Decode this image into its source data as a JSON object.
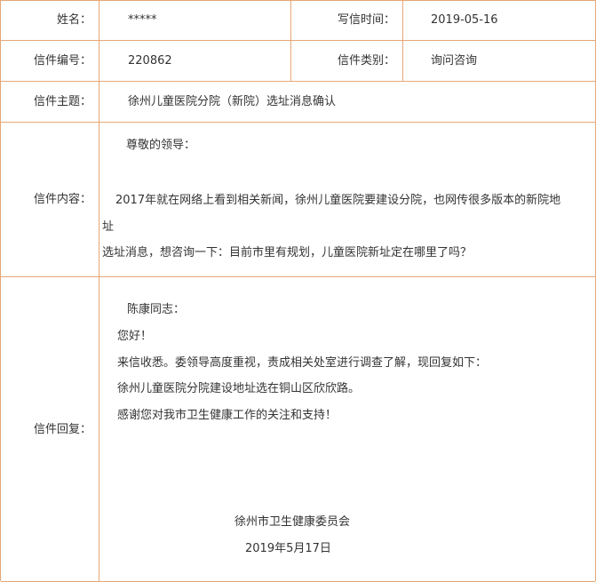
{
  "fields": {
    "name_label": "姓名：",
    "name_value": "*****",
    "date_label": "写信时间：",
    "date_value": "2019-05-16",
    "id_label": "信件编号：",
    "id_value": "220862",
    "category_label": "信件类别：",
    "category_value": "询问咨询",
    "subject_label": "信件主题：",
    "subject_value": "徐州儿童医院分院（新院）选址消息确认"
  },
  "content": {
    "label": "信件内容：",
    "salutation": "尊敬的领导：",
    "line1": "2017年就在网络上看到相关新闻，徐州儿童医院要建设分院，也网传很多版本的新院地",
    "line2": "址",
    "line3": "选址消息，想咨询一下：目前市里有规划，儿童医院新址定在哪里了吗？"
  },
  "reply": {
    "label": "信件回复：",
    "salutation": "陈康同志：",
    "greeting": "您好！",
    "line1": "来信收悉。委领导高度重视，责成相关处室进行调查了解，现回复如下：",
    "line2": "徐州儿童医院分院建设地址选在铜山区欣欣路。",
    "line3": "感谢您对我市卫生健康工作的关注和支持！",
    "signature": "徐州市卫生健康委员会",
    "date": "2019年5月17日"
  }
}
